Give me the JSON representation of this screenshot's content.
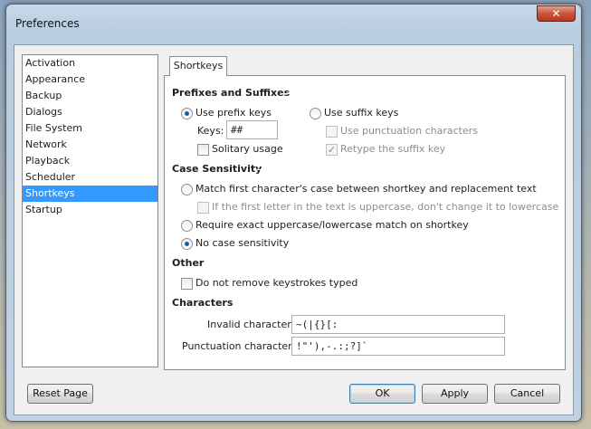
{
  "window": {
    "title": "Preferences",
    "close_glyph": "✕"
  },
  "nav": {
    "items": [
      "Activation",
      "Appearance",
      "Backup",
      "Dialogs",
      "File System",
      "Network",
      "Playback",
      "Scheduler",
      "Shortkeys",
      "Startup"
    ],
    "selected": "Shortkeys"
  },
  "tab": {
    "label": "Shortkeys"
  },
  "prefixes": {
    "title": "Prefixes and Suffixes",
    "use_prefix_label": "Use prefix keys",
    "keys_label": "Keys:",
    "keys_value": "##",
    "solitary_label": "Solitary usage",
    "use_suffix_label": "Use suffix keys",
    "punct_label": "Use punctuation characters",
    "retype_label": "Retype the suffix key",
    "retype_check_glyph": "✓"
  },
  "case": {
    "title": "Case Sensitivity",
    "match_first_label": "Match first character's case between shortkey and replacement text",
    "first_upper_label": "If the first letter in the text is uppercase, don't change it to lowercase",
    "exact_label": "Require exact uppercase/lowercase match on shortkey",
    "none_label": "No case sensitivity"
  },
  "other": {
    "title": "Other",
    "keep_keystrokes_label": "Do not remove keystrokes typed"
  },
  "characters": {
    "title": "Characters",
    "invalid_label": "Invalid characters:",
    "invalid_value": "~(|{}[:",
    "punct_label": "Punctuation characters:",
    "punct_value": "!\"'),-.:;?]`"
  },
  "buttons": {
    "reset": "Reset Page",
    "ok": "OK",
    "apply": "Apply",
    "cancel": "Cancel"
  }
}
